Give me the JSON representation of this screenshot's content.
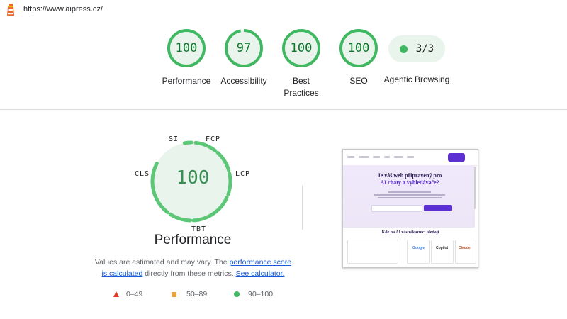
{
  "header": {
    "url": "https://www.aipress.cz/",
    "logo_icon": "lighthouse-icon"
  },
  "gauges": [
    {
      "score": "100",
      "label": "Performance"
    },
    {
      "score": "97",
      "label": "Accessibility"
    },
    {
      "score": "100",
      "label": "Best Practices"
    },
    {
      "score": "100",
      "label": "SEO"
    }
  ],
  "agentic": {
    "fraction": "3/3",
    "label": "Agentic Browsing"
  },
  "performance": {
    "score": "100",
    "title": "Performance",
    "metrics": {
      "si": "SI",
      "fcp": "FCP",
      "lcp": "LCP",
      "tbt": "TBT",
      "cls": "CLS"
    },
    "description": {
      "part1": "Values are estimated and may vary. The ",
      "link1": "performance score is calculated",
      "part2": " directly from these metrics. ",
      "link2": "See calculator."
    },
    "legend": [
      {
        "range": "0–49",
        "icon": "triangle-icon",
        "color": "#e03b24"
      },
      {
        "range": "50–89",
        "icon": "square-icon",
        "color": "#e8a33b"
      },
      {
        "range": "90–100",
        "icon": "circle-icon",
        "color": "#3fb861"
      }
    ]
  },
  "thumbnail": {
    "headline_1": "Je váš web připravený pro",
    "headline_2": "AI chaty a vyhledávače?",
    "subheading": "Kde na AI vás zákazníci hledají",
    "logos": [
      "Google",
      "Copilot",
      "Claude"
    ]
  },
  "colors": {
    "pass": "#3fb861",
    "pass_bg": "#e8f4ec",
    "pass_text": "#0b7a2a",
    "accent": "#5b2fd1"
  }
}
